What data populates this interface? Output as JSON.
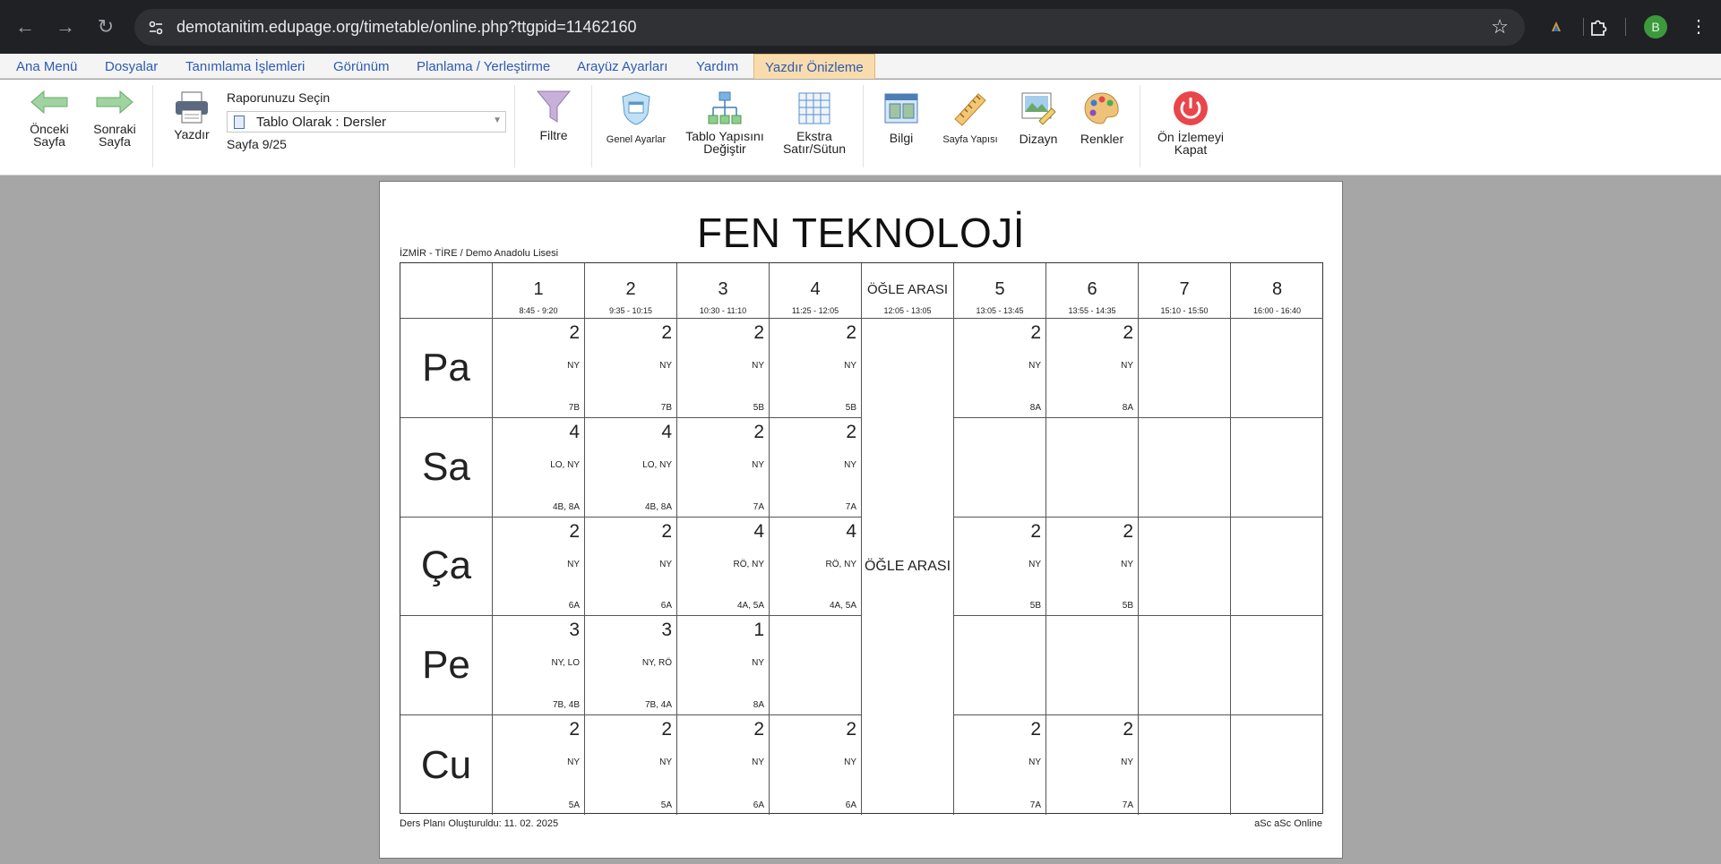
{
  "browser": {
    "url": "demotanitim.edupage.org/timetable/online.php?ttgpid=11462160",
    "avatar_letter": "B"
  },
  "menu": [
    "Ana Menü",
    "Dosyalar",
    "Tanımlama İşlemleri",
    "Görünüm",
    "Planlama / Yerleştirme",
    "Arayüz Ayarları",
    "Yardım",
    "Yazdır Önizleme"
  ],
  "toolbar": {
    "prev_line1": "Önceki",
    "prev_line2": "Sayfa",
    "next_line1": "Sonraki",
    "next_line2": "Sayfa",
    "print": "Yazdır",
    "report_label": "Raporunuzu Seçin",
    "report_value": "Tablo Olarak : Dersler",
    "page_info": "Sayfa 9/25",
    "filter": "Filtre",
    "general": "Genel Ayarlar",
    "structure_line1": "Tablo Yapısını",
    "structure_line2": "Değiştir",
    "extra_line1": "Ekstra",
    "extra_line2": "Satır/Sütun",
    "info": "Bilgi",
    "page_setup": "Sayfa Yapısı",
    "design": "Dizayn",
    "colors": "Renkler",
    "close_line1": "Ön İzlemeyi",
    "close_line2": "Kapat"
  },
  "document": {
    "title": "FEN TEKNOLOJİ",
    "school": "İZMİR - TİRE / Demo Anadolu Lisesi",
    "created": "Ders Planı Oluşturuldu: 11. 02. 2025",
    "brand": "aSc aSc Online"
  },
  "timetable": {
    "periods": [
      {
        "num": "1",
        "time": "8:45 - 9:20"
      },
      {
        "num": "2",
        "time": "9:35 - 10:15"
      },
      {
        "num": "3",
        "time": "10:30 - 11:10"
      },
      {
        "num": "4",
        "time": "11:25 - 12:05"
      },
      {
        "label": "ÖĞLE ARASI",
        "time": "12:05 - 13:05"
      },
      {
        "num": "5",
        "time": "13:05 - 13:45"
      },
      {
        "num": "6",
        "time": "13:55 - 14:35"
      },
      {
        "num": "7",
        "time": "15:10 - 15:50"
      },
      {
        "num": "8",
        "time": "16:00 - 16:40"
      }
    ],
    "break_label": "ÖĞLE ARASI",
    "days": [
      {
        "name": "Pa",
        "cells": [
          {
            "num": "2",
            "subj": "NY",
            "cls": "7B"
          },
          {
            "num": "2",
            "subj": "NY",
            "cls": "7B"
          },
          {
            "num": "2",
            "subj": "NY",
            "cls": "5B"
          },
          {
            "num": "2",
            "subj": "NY",
            "cls": "5B"
          },
          {
            "num": "2",
            "subj": "NY",
            "cls": "8A"
          },
          {
            "num": "2",
            "subj": "NY",
            "cls": "8A"
          },
          null,
          null
        ]
      },
      {
        "name": "Sa",
        "cells": [
          {
            "num": "4",
            "subj": "LO, NY",
            "cls": "4B, 8A"
          },
          {
            "num": "4",
            "subj": "LO, NY",
            "cls": "4B, 8A"
          },
          {
            "num": "2",
            "subj": "NY",
            "cls": "7A"
          },
          {
            "num": "2",
            "subj": "NY",
            "cls": "7A"
          },
          null,
          null,
          null,
          null
        ]
      },
      {
        "name": "Ça",
        "cells": [
          {
            "num": "2",
            "subj": "NY",
            "cls": "6A"
          },
          {
            "num": "2",
            "subj": "NY",
            "cls": "6A"
          },
          {
            "num": "4",
            "subj": "RÖ, NY",
            "cls": "4A, 5A"
          },
          {
            "num": "4",
            "subj": "RÖ, NY",
            "cls": "4A, 5A"
          },
          {
            "num": "2",
            "subj": "NY",
            "cls": "5B"
          },
          {
            "num": "2",
            "subj": "NY",
            "cls": "5B"
          },
          null,
          null
        ]
      },
      {
        "name": "Pe",
        "cells": [
          {
            "num": "3",
            "subj": "NY, LO",
            "cls": "7B, 4B"
          },
          {
            "num": "3",
            "subj": "NY, RÖ",
            "cls": "7B, 4A"
          },
          {
            "num": "1",
            "subj": "NY",
            "cls": "8A"
          },
          null,
          null,
          null,
          null,
          null
        ]
      },
      {
        "name": "Cu",
        "cells": [
          {
            "num": "2",
            "subj": "NY",
            "cls": "5A"
          },
          {
            "num": "2",
            "subj": "NY",
            "cls": "5A"
          },
          {
            "num": "2",
            "subj": "NY",
            "cls": "6A"
          },
          {
            "num": "2",
            "subj": "NY",
            "cls": "6A"
          },
          {
            "num": "2",
            "subj": "NY",
            "cls": "7A"
          },
          {
            "num": "2",
            "subj": "NY",
            "cls": "7A"
          },
          null,
          null
        ]
      }
    ]
  }
}
